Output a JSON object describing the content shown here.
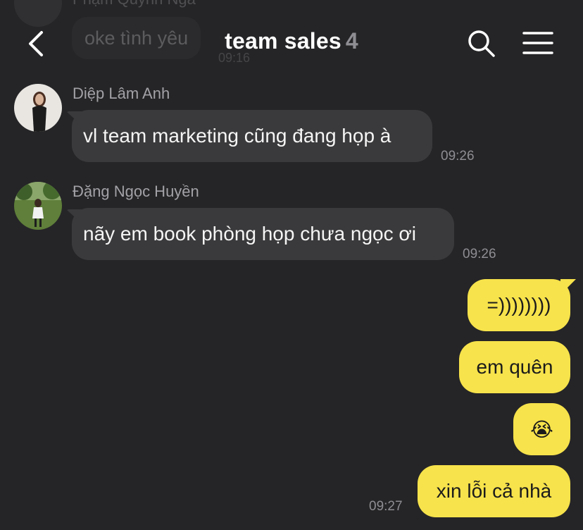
{
  "ghost": {
    "sender": "Phạm Quỳnh Nga",
    "message": "oke tình yêu",
    "time": "09:16"
  },
  "header": {
    "title": "team sales",
    "member_count": "4"
  },
  "messages": [
    {
      "sender": "Diệp Lâm Anh",
      "text": "vl team marketing cũng đang họp à",
      "time": "09:26"
    },
    {
      "sender": "Đặng Ngọc Huyền",
      "text": "nãy em book phòng họp chưa ngọc ơi",
      "time": "09:26"
    }
  ],
  "outgoing": [
    {
      "text": "=))))))))"
    },
    {
      "text": "em quên"
    },
    {
      "text": "😭"
    },
    {
      "text": "xin lỗi cả nhà",
      "time": "09:27"
    }
  ],
  "colors": {
    "background": "#252527",
    "incoming_bubble": "#3a3a3c",
    "outgoing_bubble": "#f7e34b"
  },
  "icons": {
    "back": "chevron-left-icon",
    "search": "search-icon",
    "menu": "hamburger-menu-icon"
  }
}
